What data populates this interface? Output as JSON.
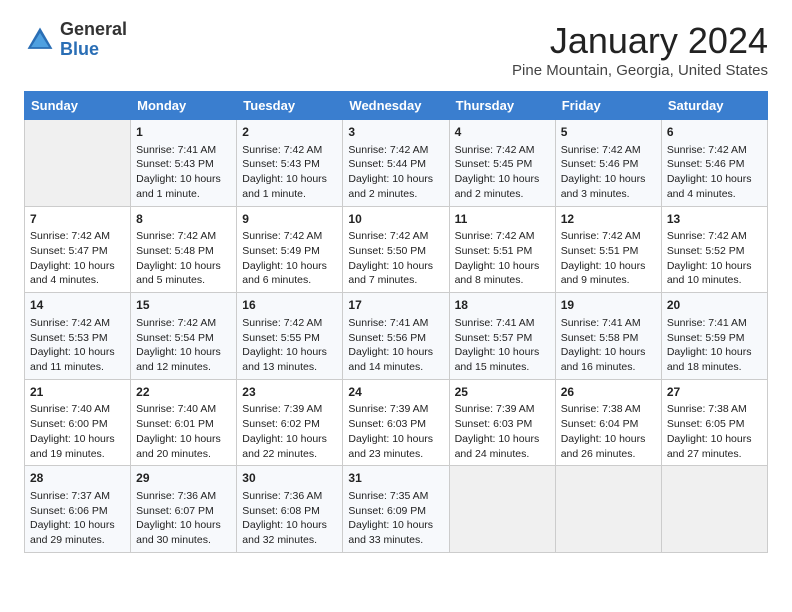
{
  "header": {
    "logo_general": "General",
    "logo_blue": "Blue",
    "month_title": "January 2024",
    "location": "Pine Mountain, Georgia, United States"
  },
  "weekdays": [
    "Sunday",
    "Monday",
    "Tuesday",
    "Wednesday",
    "Thursday",
    "Friday",
    "Saturday"
  ],
  "weeks": [
    [
      {
        "day": "",
        "sunrise": "",
        "sunset": "",
        "daylight": ""
      },
      {
        "day": "1",
        "sunrise": "Sunrise: 7:41 AM",
        "sunset": "Sunset: 5:43 PM",
        "daylight": "Daylight: 10 hours and 1 minute."
      },
      {
        "day": "2",
        "sunrise": "Sunrise: 7:42 AM",
        "sunset": "Sunset: 5:43 PM",
        "daylight": "Daylight: 10 hours and 1 minute."
      },
      {
        "day": "3",
        "sunrise": "Sunrise: 7:42 AM",
        "sunset": "Sunset: 5:44 PM",
        "daylight": "Daylight: 10 hours and 2 minutes."
      },
      {
        "day": "4",
        "sunrise": "Sunrise: 7:42 AM",
        "sunset": "Sunset: 5:45 PM",
        "daylight": "Daylight: 10 hours and 2 minutes."
      },
      {
        "day": "5",
        "sunrise": "Sunrise: 7:42 AM",
        "sunset": "Sunset: 5:46 PM",
        "daylight": "Daylight: 10 hours and 3 minutes."
      },
      {
        "day": "6",
        "sunrise": "Sunrise: 7:42 AM",
        "sunset": "Sunset: 5:46 PM",
        "daylight": "Daylight: 10 hours and 4 minutes."
      }
    ],
    [
      {
        "day": "7",
        "sunrise": "Sunrise: 7:42 AM",
        "sunset": "Sunset: 5:47 PM",
        "daylight": "Daylight: 10 hours and 4 minutes."
      },
      {
        "day": "8",
        "sunrise": "Sunrise: 7:42 AM",
        "sunset": "Sunset: 5:48 PM",
        "daylight": "Daylight: 10 hours and 5 minutes."
      },
      {
        "day": "9",
        "sunrise": "Sunrise: 7:42 AM",
        "sunset": "Sunset: 5:49 PM",
        "daylight": "Daylight: 10 hours and 6 minutes."
      },
      {
        "day": "10",
        "sunrise": "Sunrise: 7:42 AM",
        "sunset": "Sunset: 5:50 PM",
        "daylight": "Daylight: 10 hours and 7 minutes."
      },
      {
        "day": "11",
        "sunrise": "Sunrise: 7:42 AM",
        "sunset": "Sunset: 5:51 PM",
        "daylight": "Daylight: 10 hours and 8 minutes."
      },
      {
        "day": "12",
        "sunrise": "Sunrise: 7:42 AM",
        "sunset": "Sunset: 5:51 PM",
        "daylight": "Daylight: 10 hours and 9 minutes."
      },
      {
        "day": "13",
        "sunrise": "Sunrise: 7:42 AM",
        "sunset": "Sunset: 5:52 PM",
        "daylight": "Daylight: 10 hours and 10 minutes."
      }
    ],
    [
      {
        "day": "14",
        "sunrise": "Sunrise: 7:42 AM",
        "sunset": "Sunset: 5:53 PM",
        "daylight": "Daylight: 10 hours and 11 minutes."
      },
      {
        "day": "15",
        "sunrise": "Sunrise: 7:42 AM",
        "sunset": "Sunset: 5:54 PM",
        "daylight": "Daylight: 10 hours and 12 minutes."
      },
      {
        "day": "16",
        "sunrise": "Sunrise: 7:42 AM",
        "sunset": "Sunset: 5:55 PM",
        "daylight": "Daylight: 10 hours and 13 minutes."
      },
      {
        "day": "17",
        "sunrise": "Sunrise: 7:41 AM",
        "sunset": "Sunset: 5:56 PM",
        "daylight": "Daylight: 10 hours and 14 minutes."
      },
      {
        "day": "18",
        "sunrise": "Sunrise: 7:41 AM",
        "sunset": "Sunset: 5:57 PM",
        "daylight": "Daylight: 10 hours and 15 minutes."
      },
      {
        "day": "19",
        "sunrise": "Sunrise: 7:41 AM",
        "sunset": "Sunset: 5:58 PM",
        "daylight": "Daylight: 10 hours and 16 minutes."
      },
      {
        "day": "20",
        "sunrise": "Sunrise: 7:41 AM",
        "sunset": "Sunset: 5:59 PM",
        "daylight": "Daylight: 10 hours and 18 minutes."
      }
    ],
    [
      {
        "day": "21",
        "sunrise": "Sunrise: 7:40 AM",
        "sunset": "Sunset: 6:00 PM",
        "daylight": "Daylight: 10 hours and 19 minutes."
      },
      {
        "day": "22",
        "sunrise": "Sunrise: 7:40 AM",
        "sunset": "Sunset: 6:01 PM",
        "daylight": "Daylight: 10 hours and 20 minutes."
      },
      {
        "day": "23",
        "sunrise": "Sunrise: 7:39 AM",
        "sunset": "Sunset: 6:02 PM",
        "daylight": "Daylight: 10 hours and 22 minutes."
      },
      {
        "day": "24",
        "sunrise": "Sunrise: 7:39 AM",
        "sunset": "Sunset: 6:03 PM",
        "daylight": "Daylight: 10 hours and 23 minutes."
      },
      {
        "day": "25",
        "sunrise": "Sunrise: 7:39 AM",
        "sunset": "Sunset: 6:03 PM",
        "daylight": "Daylight: 10 hours and 24 minutes."
      },
      {
        "day": "26",
        "sunrise": "Sunrise: 7:38 AM",
        "sunset": "Sunset: 6:04 PM",
        "daylight": "Daylight: 10 hours and 26 minutes."
      },
      {
        "day": "27",
        "sunrise": "Sunrise: 7:38 AM",
        "sunset": "Sunset: 6:05 PM",
        "daylight": "Daylight: 10 hours and 27 minutes."
      }
    ],
    [
      {
        "day": "28",
        "sunrise": "Sunrise: 7:37 AM",
        "sunset": "Sunset: 6:06 PM",
        "daylight": "Daylight: 10 hours and 29 minutes."
      },
      {
        "day": "29",
        "sunrise": "Sunrise: 7:36 AM",
        "sunset": "Sunset: 6:07 PM",
        "daylight": "Daylight: 10 hours and 30 minutes."
      },
      {
        "day": "30",
        "sunrise": "Sunrise: 7:36 AM",
        "sunset": "Sunset: 6:08 PM",
        "daylight": "Daylight: 10 hours and 32 minutes."
      },
      {
        "day": "31",
        "sunrise": "Sunrise: 7:35 AM",
        "sunset": "Sunset: 6:09 PM",
        "daylight": "Daylight: 10 hours and 33 minutes."
      },
      {
        "day": "",
        "sunrise": "",
        "sunset": "",
        "daylight": ""
      },
      {
        "day": "",
        "sunrise": "",
        "sunset": "",
        "daylight": ""
      },
      {
        "day": "",
        "sunrise": "",
        "sunset": "",
        "daylight": ""
      }
    ]
  ]
}
